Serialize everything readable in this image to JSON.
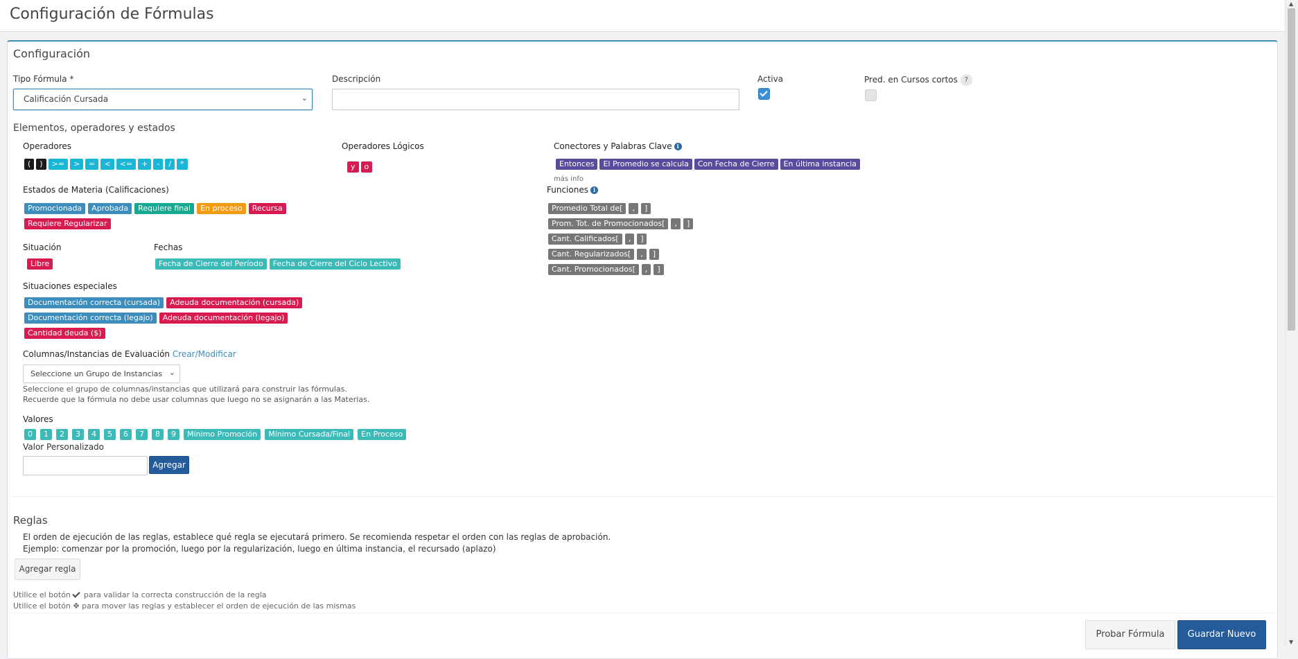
{
  "page": {
    "title": "Configuración de Fórmulas"
  },
  "config": {
    "title": "Configuración",
    "tipo_label": "Tipo Fórmula *",
    "tipo_value": "Calificación Cursada",
    "descripcion_label": "Descripción",
    "descripcion_value": "",
    "activa_label": "Activa",
    "activa_checked": true,
    "pred_label": "Pred. en Cursos cortos",
    "pred_help": "?",
    "pred_checked": false
  },
  "elements": {
    "title": "Elementos, operadores y estados",
    "operadores_label": "Operadores",
    "operadores": [
      "(",
      ")",
      ">=",
      ">",
      "=",
      "<",
      "<=",
      "+",
      "-",
      "/",
      "*"
    ],
    "logicos_label": "Operadores Lógicos",
    "logicos": [
      "y",
      "o"
    ],
    "conectores_label": "Conectores y Palabras Clave",
    "conectores": [
      "Entonces",
      "El Promedio se calcula",
      "Con Fecha de Cierre",
      "En última instancia"
    ],
    "mas_info": "más info",
    "estados_label": "Estados de Materia (Calificaciones)",
    "estados": [
      {
        "label": "Promocionada",
        "color": "#3c8dbc"
      },
      {
        "label": "Aprobada",
        "color": "#3c8dbc"
      },
      {
        "label": "Requiere final",
        "color": "#16a890"
      },
      {
        "label": "En proceso",
        "color": "#f39c12"
      },
      {
        "label": "Recursa",
        "color": "#d81b50"
      },
      {
        "label": "Requiere Regularizar",
        "color": "#d81b50"
      }
    ],
    "funciones_label": "Funciones",
    "funciones": [
      {
        "name": "Promedio Total de[",
        "parts": [
          ",",
          "]"
        ]
      },
      {
        "name": "Prom. Tot. de Promocionados[",
        "parts": [
          ",",
          "]"
        ]
      },
      {
        "name": "Cant. Calificados[",
        "parts": [
          ",",
          "]"
        ]
      },
      {
        "name": "Cant. Regularizados[",
        "parts": [
          ",",
          "]"
        ]
      },
      {
        "name": "Cant. Promocionados[",
        "parts": [
          ",",
          "]"
        ]
      }
    ],
    "situacion_label": "Situación",
    "situacion": [
      "Libre"
    ],
    "fechas_label": "Fechas",
    "fechas": [
      "Fecha de Cierre del Período",
      "Fecha de Cierre del Ciclo Lectivo"
    ],
    "especiales_label": "Situaciones especiales",
    "especiales": [
      {
        "label": "Documentación correcta (cursada)",
        "color": "#3c8dbc"
      },
      {
        "label": "Adeuda documentación (cursada)",
        "color": "#d81b50"
      },
      {
        "label": "Documentación correcta (legajo)",
        "color": "#3c8dbc"
      },
      {
        "label": "Adeuda documentación (legajo)",
        "color": "#d81b50"
      },
      {
        "label": "Cantidad deuda ($)",
        "color": "#d81b50"
      }
    ],
    "columnas_label": "Columnas/Instancias de Evaluación",
    "columnas_link": "Crear/Modificar",
    "columnas_select": "Seleccione un Grupo de Instancias",
    "columnas_help1": "Seleccione el grupo de columnas/instancias que utilizará para construir las fórmulas.",
    "columnas_help2": "Recuerde que la fórmula no debe usar columnas que luego no se asignarán a las Materias.",
    "valores_label": "Valores",
    "valores": [
      "0",
      "1",
      "2",
      "3",
      "4",
      "5",
      "6",
      "7",
      "8",
      "9",
      "Mínimo Promoción",
      "Mínimo Cursada/Final",
      "En Proceso"
    ],
    "valor_pers_label": "Valor Personalizado",
    "agregar_label": "Agregar"
  },
  "reglas": {
    "title": "Reglas",
    "desc1": "El orden de ejecución de las reglas, establece qué regla se ejecutará primero. Se recomienda respetar el orden con las reglas de aprobación.",
    "desc2": "Ejemplo: comenzar por la promoción, luego por la regularización, luego en última instancia, el recursado (aplazo)",
    "agregar_regla": "Agregar regla",
    "hint1_a": "Utilice el botón",
    "hint1_b": "para validar la correcta construcción de la regla",
    "hint2_a": "Utilice el botón",
    "hint2_b": "para mover las reglas y establecer el orden de ejecución de las mismas"
  },
  "footer": {
    "probar": "Probar Fórmula",
    "guardar": "Guardar Nuevo"
  }
}
